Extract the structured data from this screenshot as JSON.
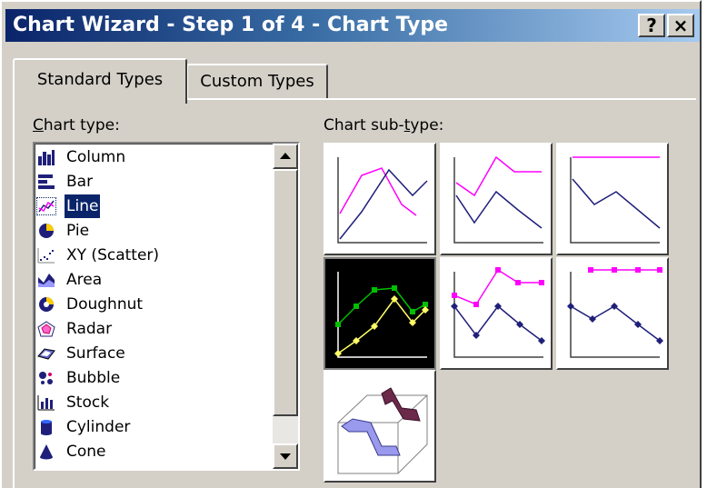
{
  "window": {
    "title": "Chart Wizard - Step 1 of 4 - Chart Type",
    "help_label": "?",
    "close_label": "×"
  },
  "tabs": [
    {
      "label": "Standard Types",
      "active": true
    },
    {
      "label": "Custom Types",
      "active": false
    }
  ],
  "chart_type": {
    "label": "hart type:",
    "label_accel": "C",
    "selected": "Line",
    "items": [
      {
        "label": "Column",
        "icon": "column-chart-icon"
      },
      {
        "label": "Bar",
        "icon": "bar-chart-icon"
      },
      {
        "label": "Line",
        "icon": "line-chart-icon"
      },
      {
        "label": "Pie",
        "icon": "pie-chart-icon"
      },
      {
        "label": "XY (Scatter)",
        "icon": "scatter-chart-icon"
      },
      {
        "label": "Area",
        "icon": "area-chart-icon"
      },
      {
        "label": "Doughnut",
        "icon": "doughnut-chart-icon"
      },
      {
        "label": "Radar",
        "icon": "radar-chart-icon"
      },
      {
        "label": "Surface",
        "icon": "surface-chart-icon"
      },
      {
        "label": "Bubble",
        "icon": "bubble-chart-icon"
      },
      {
        "label": "Stock",
        "icon": "stock-chart-icon"
      },
      {
        "label": "Cylinder",
        "icon": "cylinder-chart-icon"
      },
      {
        "label": "Cone",
        "icon": "cone-chart-icon"
      }
    ]
  },
  "chart_subtype": {
    "label_pre": "Chart sub-",
    "label_accel": "t",
    "label_post": "ype:",
    "selected_index": 3,
    "tiles": [
      "line",
      "stacked-line",
      "100-stacked-line",
      "line-with-markers",
      "stacked-line-with-markers",
      "100-stacked-line-with-markers",
      "3d-line"
    ]
  },
  "colors": {
    "titlebar_start": "#0a246a",
    "titlebar_end": "#a6caf0",
    "selection": "#0a246a",
    "dialog_face": "#d4d0c8",
    "series_magenta": "#ff00ff",
    "series_navy": "#1f1f7a",
    "series_green": "#00c000",
    "series_yellow": "#ffff66"
  }
}
